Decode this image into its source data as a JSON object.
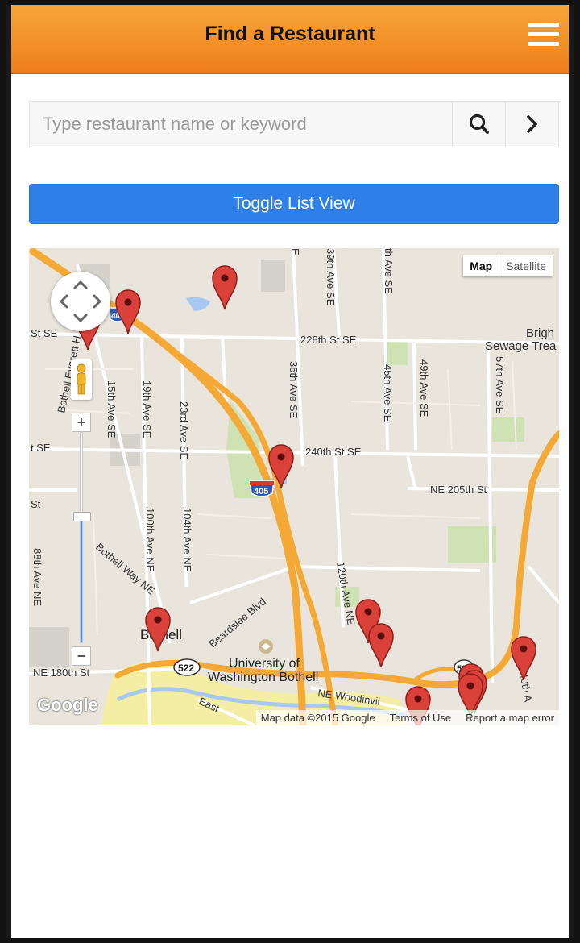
{
  "header": {
    "title": "Find a Restaurant",
    "menu_icon": "hamburger-menu-icon",
    "background_start": "#f6a63a",
    "background_end": "#ef7e1c"
  },
  "search": {
    "placeholder": "Type restaurant name or keyword",
    "value": "",
    "search_icon": "magnifier-icon",
    "go_icon": "chevron-right-icon"
  },
  "toggle_button": {
    "label": "Toggle List View",
    "color": "#2f7fe8"
  },
  "map": {
    "type_buttons": {
      "map": "Map",
      "satellite": "Satellite",
      "selected": "Map"
    },
    "zoom_level": 0.6,
    "logo": "Google",
    "attribution": {
      "data": "Map data ©2015 Google",
      "terms": "Terms of Use",
      "report": "Report a map error"
    },
    "streets": {
      "s228": "228th St SE",
      "s240": "240th St SE",
      "ne205": "NE 205th St",
      "ne180": "NE 180th St",
      "a15": "15th Ave SE",
      "a19": "19th Ave SE",
      "a23": "23rd Ave SE",
      "a35": "35th Ave SE",
      "a39": "39th Ave SE",
      "a45": "45th Ave SE",
      "a49": "49th Ave SE",
      "a57": "57th Ave SE",
      "a100": "100th Ave NE",
      "a104": "104th Ave NE",
      "a88": "88th Ave NE",
      "a120": "120th Ave NE",
      "bothell_everett": "Bothell Everett H",
      "bothell_way": "Bothell Way NE",
      "beardslee": "Beardslee Blvd",
      "woodinville": "NE Woodinvil",
      "east": "East",
      "stse_left": "St SE",
      "tse_left": "t SE",
      "st_left": "St",
      "ave_top": "th Ave SE",
      "ave_top2": "E",
      "ave140": "140th A"
    },
    "places": {
      "bothell": "Bothell",
      "uw1": "University of",
      "uw2": "Washington Bothell",
      "bright1": "Brigh",
      "bright2": "Sewage Trea"
    },
    "shields": {
      "i405": "405",
      "i405_top": "40",
      "sr522": "522",
      "sr522b": "52"
    },
    "pin_color": "#d9413a",
    "pin_count": 12
  }
}
